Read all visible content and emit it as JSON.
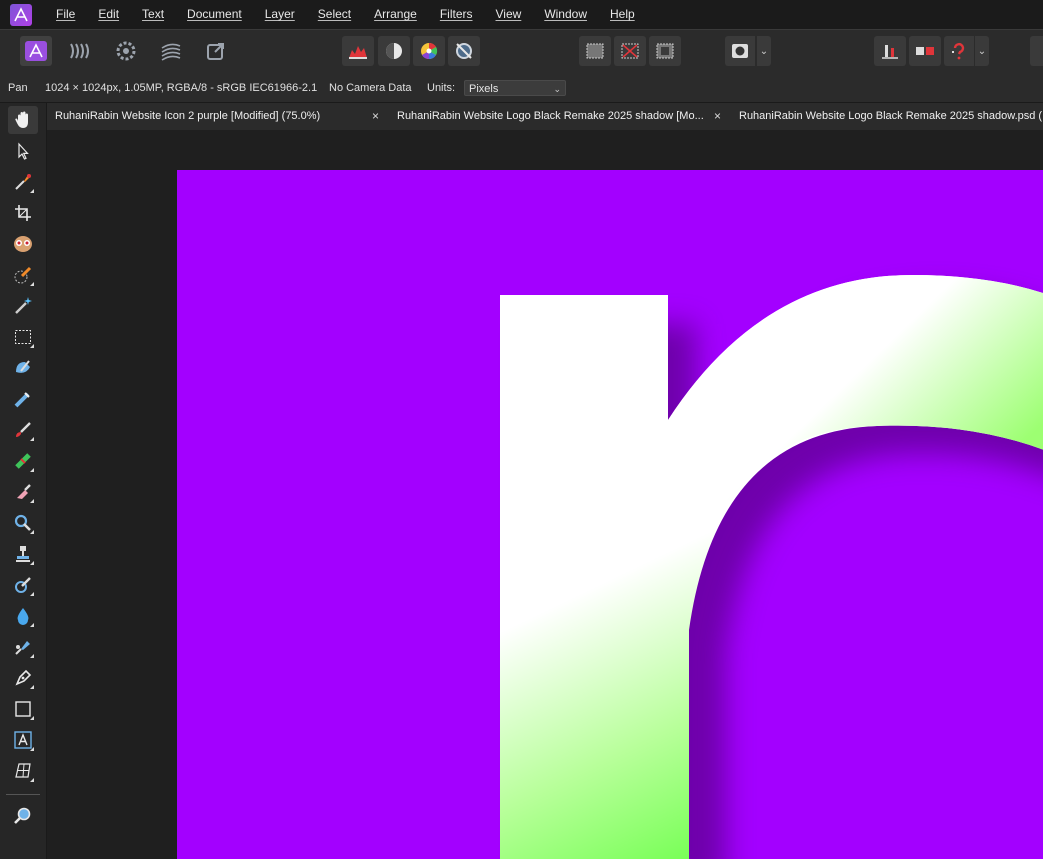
{
  "menu": {
    "items": [
      "File",
      "Edit",
      "Text",
      "Document",
      "Layer",
      "Select",
      "Arrange",
      "Filters",
      "View",
      "Window",
      "Help"
    ]
  },
  "toolbar": {
    "personas": [
      "photo-persona-icon",
      "liquify-persona-icon",
      "develop-persona-icon",
      "tone-mapping-persona-icon",
      "export-persona-icon"
    ],
    "adjust": [
      "auto-levels-icon",
      "auto-contrast-icon",
      "auto-colors-icon",
      "auto-white-balance-icon"
    ],
    "selection": [
      "select-all-icon",
      "deselect-icon",
      "invert-selection-icon"
    ],
    "mask": [
      "quick-mask-icon"
    ],
    "snapping": [
      "alignment-icon",
      "snapping-icon",
      "help-icon"
    ]
  },
  "context": {
    "tool_name": "Pan",
    "doc_info": "1024 × 1024px, 1.05MP, RGBA/8 - sRGB IEC61966-2.1",
    "camera": "No Camera Data",
    "units_label": "Units:",
    "units_value": "Pixels"
  },
  "tabs": [
    {
      "title": "RuhaniRabin Website Icon 2 purple [Modified] (75.0%)",
      "close": "×"
    },
    {
      "title": "RuhaniRabin Website Logo Black Remake 2025 shadow [Mo...",
      "close": "×"
    },
    {
      "title": "RuhaniRabin Website Logo Black Remake 2025 shadow.psd (..."
    }
  ],
  "tools": [
    "hand-tool-icon",
    "move-tool-icon",
    "color-picker-icon",
    "crop-tool-icon",
    "red-eye-tool-icon",
    "selection-brush-icon",
    "flood-select-icon",
    "marquee-tool-icon",
    "paint-mixer-icon",
    "inpainting-brush-icon",
    "paint-brush-icon",
    "healing-brush-icon",
    "erase-brush-icon",
    "dodge-brush-icon",
    "clone-brush-icon",
    "blur-brush-icon",
    "smudge-brush-icon",
    "pen-tool-icon",
    "rectangle-tool-icon",
    "text-tool-icon",
    "mesh-warp-icon",
    "zoom-tool-icon"
  ],
  "colors": {
    "canvas_bg": "#a300ff",
    "letter_top": "#ffffff",
    "letter_bottom": "#66ff44",
    "accent": "#e0353a"
  }
}
